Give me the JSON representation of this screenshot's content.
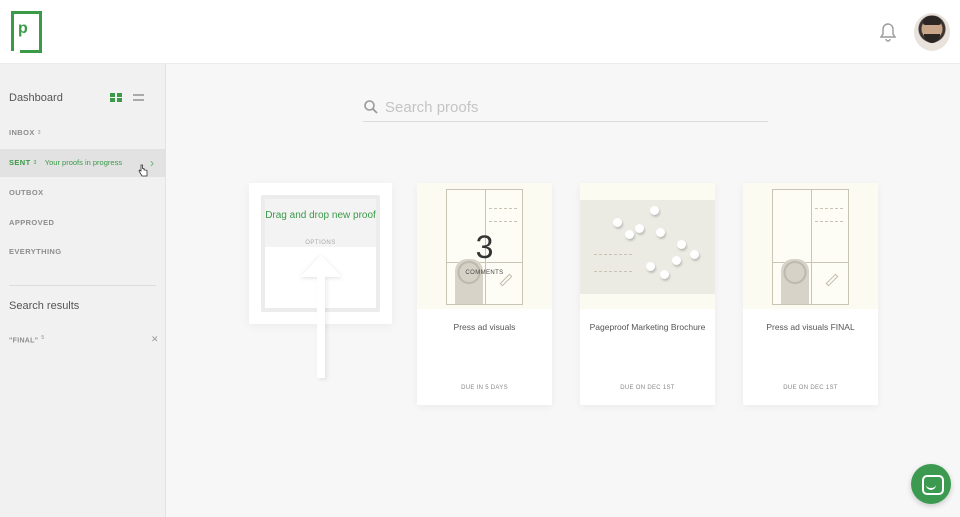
{
  "header": {
    "logo_letter": "p",
    "icons": [
      "bell-icon",
      "user-avatar"
    ]
  },
  "sidebar": {
    "title": "Dashboard",
    "view_toggle": [
      "grid-view-icon",
      "list-view-icon"
    ],
    "items": [
      {
        "label": "INBOX",
        "count": "3"
      },
      {
        "label": "SENT",
        "count": "3",
        "sub": "Your proofs in progress",
        "active": true
      },
      {
        "label": "OUTBOX"
      },
      {
        "label": "APPROVED"
      },
      {
        "label": "EVERYTHING"
      }
    ],
    "search_results_title": "Search results",
    "search_results": [
      {
        "label": "\"FINAL\"",
        "count": "5"
      }
    ]
  },
  "search": {
    "placeholder": "Search proofs"
  },
  "dropzone": {
    "title": "Drag and drop new proof",
    "options": "OPTIONS"
  },
  "cards": [
    {
      "title": "Press ad visuals",
      "due": "DUE IN 5 DAYS",
      "comments_count": "3",
      "comments_label": "COMMENTS"
    },
    {
      "title": "Pageproof Marketing Brochure",
      "due": "DUE ON DEC 1ST"
    },
    {
      "title": "Press ad visuals FINAL",
      "due": "DUE ON DEC 1ST"
    }
  ],
  "colors": {
    "accent": "#3a9a48",
    "sidebar_bg": "#f1f1f1",
    "active_bg": "#e2e2e2"
  }
}
